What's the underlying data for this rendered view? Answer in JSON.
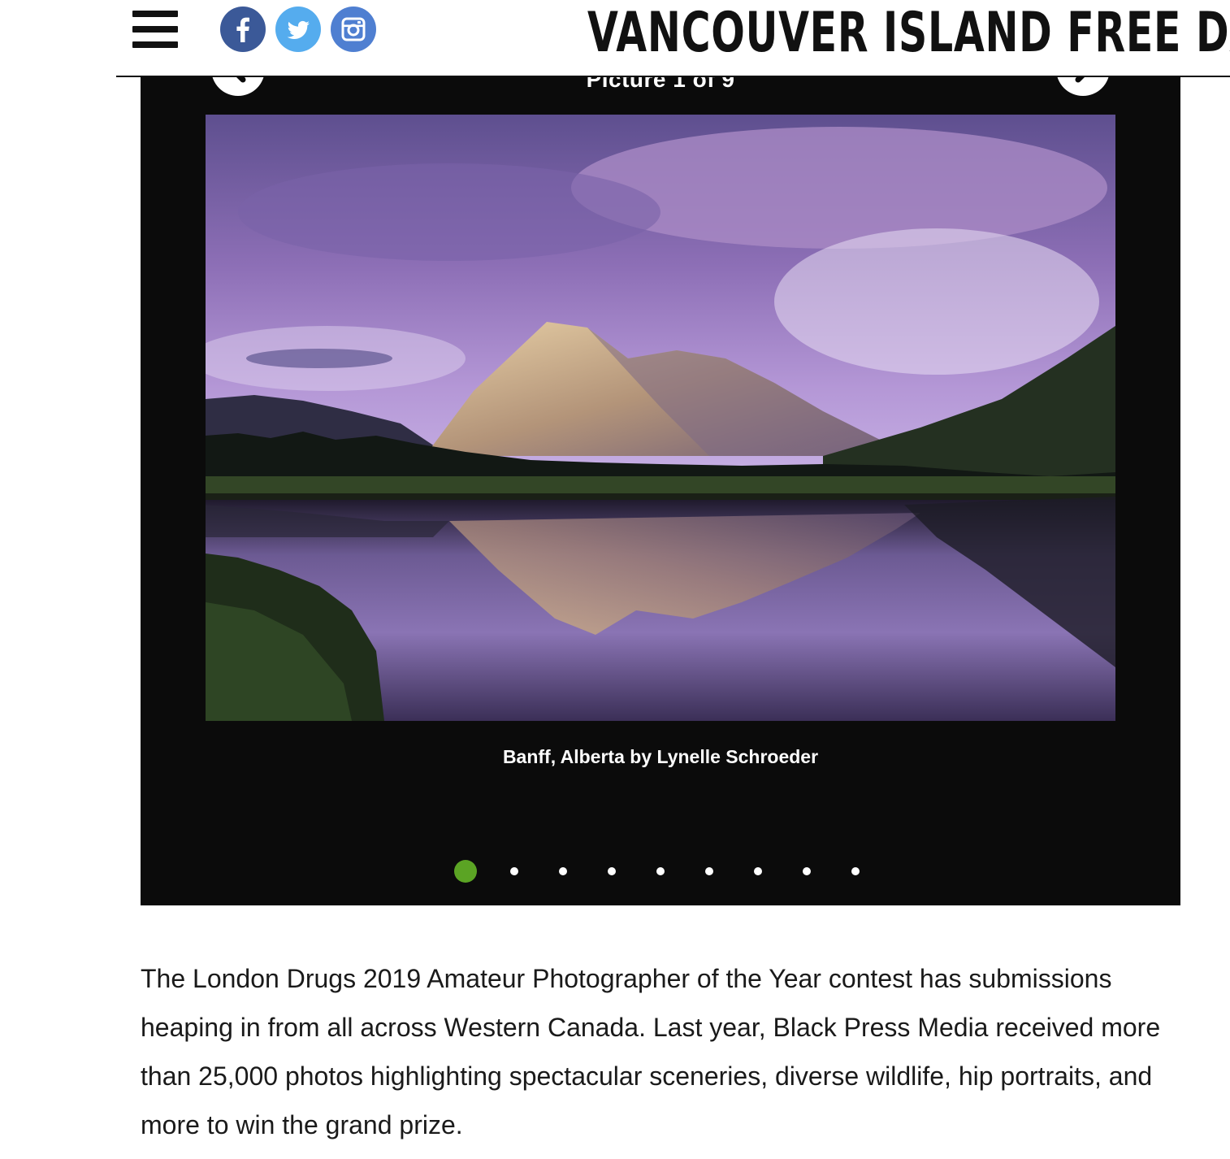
{
  "header": {
    "site_title": "VANCOUVER ISLAND FREE DA",
    "menu_icon": "hamburger-menu-icon",
    "social": [
      {
        "name": "facebook",
        "icon": "facebook-icon",
        "color": "#3b5998"
      },
      {
        "name": "twitter",
        "icon": "twitter-icon",
        "color": "#55acee"
      },
      {
        "name": "instagram",
        "icon": "instagram-icon",
        "color": "#4f7fd1"
      }
    ]
  },
  "gallery": {
    "counter": "Picture 1 of 9",
    "caption": "Banff, Alberta by Lynelle Schroeder",
    "prev_icon": "chevron-left-icon",
    "next_icon": "chevron-right-icon",
    "total": 9,
    "active_index": 0,
    "active_dot_color": "#5ba424"
  },
  "article": {
    "paragraph": "The London Drugs 2019 Amateur Photographer of the Year contest has submissions heaping in from all across Western Canada. Last year, Black Press Media received more than 25,000 photos highlighting spectacular sceneries, diverse wildlife, hip portraits, and more to win the grand prize."
  }
}
